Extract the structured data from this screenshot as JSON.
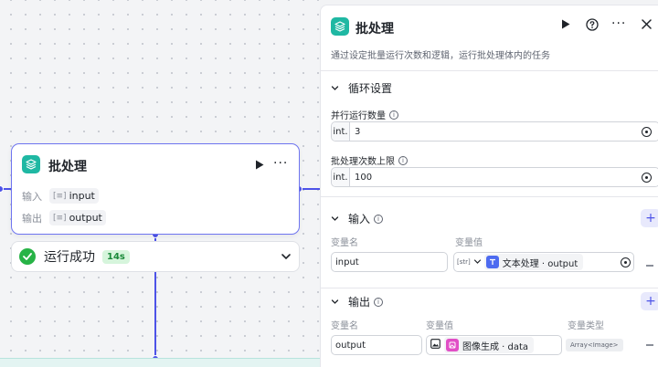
{
  "node": {
    "title": "批处理",
    "input_label": "输入",
    "input_value": "input",
    "output_label": "输出",
    "output_value": "output"
  },
  "status": {
    "text": "运行成功",
    "duration": "14s"
  },
  "panel": {
    "title": "批处理",
    "description": "通过设定批量运行次数和逻辑，运行批处理体内的任务",
    "loop_section": {
      "title": "循环设置",
      "parallel_label": "并行运行数量",
      "parallel_prefix": "int.",
      "parallel_value": "3",
      "max_label": "批处理次数上限",
      "max_prefix": "int.",
      "max_value": "100"
    },
    "input_section": {
      "title": "输入",
      "add_label": "+",
      "col_name": "变量名",
      "col_value": "变量值",
      "row_name": "input",
      "row_type_glyph": "[str]",
      "row_ref": "文本处理 · output"
    },
    "output_section": {
      "title": "输出",
      "add_label": "+",
      "col_name": "变量名",
      "col_value": "变量值",
      "col_type": "变量类型",
      "row_name": "output",
      "row_ref": "图像生成 · data",
      "row_type": "Array<Image>"
    }
  },
  "colors": {
    "accent": "#4d53e8",
    "node_icon": "#1fb8a3",
    "success": "#27b346",
    "image_ref": "#e14fc6",
    "text_ref": "#4d6bf0"
  }
}
